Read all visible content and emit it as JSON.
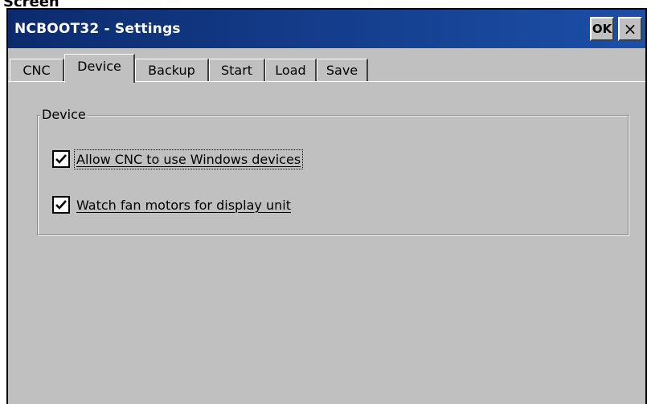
{
  "caption": "Screen",
  "window": {
    "title": "NCBOOT32 - Settings",
    "ok_label": "OK",
    "close_label": "×"
  },
  "tabs": [
    {
      "label": "CNC",
      "active": false
    },
    {
      "label": "Device",
      "active": true
    },
    {
      "label": "Backup",
      "active": false
    },
    {
      "label": "Start",
      "active": false
    },
    {
      "label": "Load",
      "active": false
    },
    {
      "label": "Save",
      "active": false
    }
  ],
  "device_group": {
    "label": "Device",
    "options": [
      {
        "label": "Allow CNC to use Windows devices",
        "checked": true,
        "icon": "checkmark-icon"
      },
      {
        "label": "Watch fan motors for display unit",
        "checked": true,
        "icon": "checkmark-icon"
      }
    ]
  },
  "colors": {
    "titlebar_start": "#0c2b6e",
    "titlebar_end": "#1c4fa8",
    "dialog_bg": "#c0c0c0"
  }
}
